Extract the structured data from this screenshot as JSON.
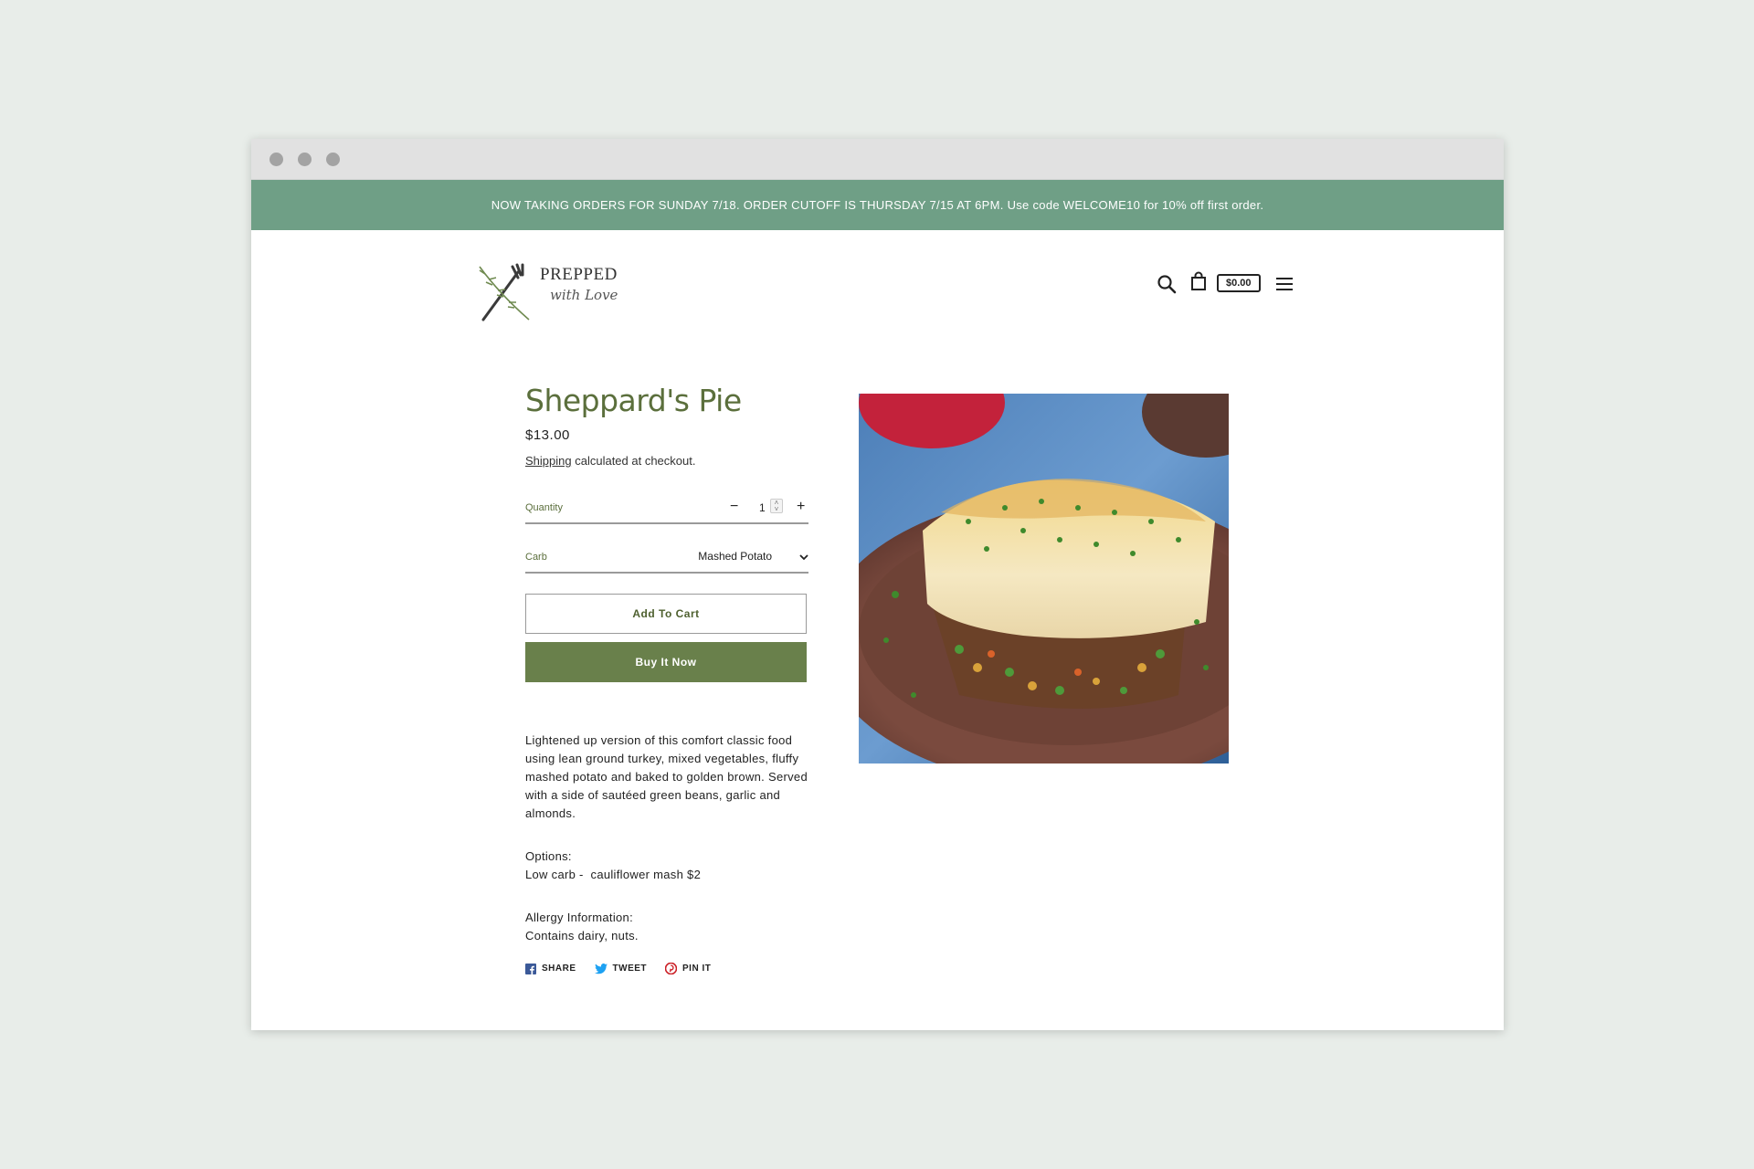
{
  "announcement": "NOW TAKING ORDERS FOR SUNDAY 7/18. ORDER CUTOFF IS THURSDAY 7/15 AT 6PM. Use code WELCOME10 for 10% off first order.",
  "brand": {
    "word": "PREPPED",
    "script": "with Love"
  },
  "header": {
    "cart_total": "$0.00",
    "icons": [
      "search-icon",
      "shopping-bag-icon",
      "menu-icon"
    ]
  },
  "product": {
    "title": "Sheppard's Pie",
    "price": "$13.00",
    "shipping_link": "Shipping",
    "shipping_text": " calculated at checkout.",
    "quantity_label": "Quantity",
    "quantity_value": "1",
    "carb_label": "Carb",
    "carb_value": "Mashed Potato",
    "add_to_cart": "Add To Cart",
    "buy_now": "Buy It Now",
    "description": "Lightened up version of this comfort classic food using lean ground turkey, mixed vegetables, fluffy mashed potato and baked to golden brown. Served with a side of sautéed green beans, garlic and almonds.",
    "options_title": "Options:",
    "options_text": "Low carb -  cauliflower mash $2",
    "allergy_title": "Allergy Information:",
    "allergy_text": "Contains dairy, nuts."
  },
  "share": {
    "share": "SHARE",
    "tweet": "TWEET",
    "pin": "PIN IT"
  },
  "colors": {
    "accent_green": "#6f9f86",
    "button_green": "#69804b",
    "title_green": "#5b6f3c",
    "facebook": "#3b5998",
    "twitter": "#1da1f2",
    "pinterest": "#cb2027"
  }
}
